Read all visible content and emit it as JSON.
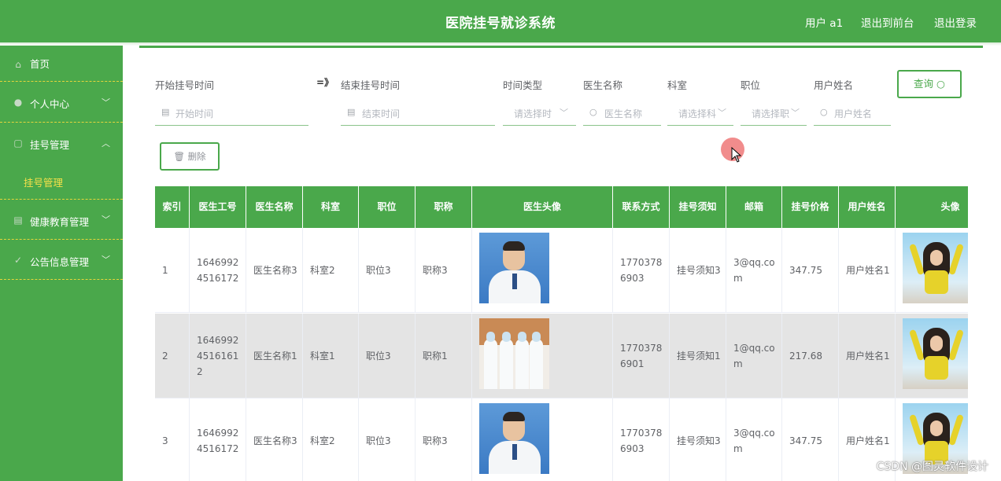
{
  "header": {
    "title": "医院挂号就诊系统",
    "user": "用户 a1",
    "to_front": "退出到前台",
    "logout": "退出登录"
  },
  "sidebar": {
    "items": [
      {
        "label": "首页",
        "icon": "home-icon"
      },
      {
        "label": "个人中心",
        "icon": "user-icon",
        "arrow": "﹀"
      },
      {
        "label": "挂号管理",
        "icon": "calendar-icon",
        "arrow": "︿"
      },
      {
        "label": "健康教育管理",
        "icon": "book-icon",
        "arrow": "﹀"
      },
      {
        "label": "公告信息管理",
        "icon": "bell-icon",
        "arrow": "﹀"
      }
    ],
    "sub_item": "挂号管理"
  },
  "filters": {
    "start_label": "开始挂号时间",
    "start_ph": "开始时间",
    "sep": "=》",
    "end_label": "结束挂号时间",
    "end_ph": "结束时间",
    "type_label": "时间类型",
    "type_ph": "请选择时",
    "doctor_label": "医生名称",
    "doctor_ph": "医生名称",
    "dept_label": "科室",
    "dept_ph": "请选择科",
    "position_label": "职位",
    "position_ph": "请选择职",
    "username_label": "用户姓名",
    "username_ph": "用户姓名",
    "query_btn": "查询 ○",
    "delete_btn": "删除"
  },
  "table": {
    "columns": [
      "索引",
      "医生工号",
      "医生名称",
      "科室",
      "职位",
      "职称",
      "医生头像",
      "联系方式",
      "挂号须知",
      "邮箱",
      "挂号价格",
      "用户姓名",
      "头像"
    ],
    "rows": [
      {
        "index": "1",
        "doc_no": "16469924516172",
        "doc_name": "医生名称3",
        "dept": "科室2",
        "position": "职位3",
        "title": "职称3",
        "photo": "doctor-photo",
        "phone": "17703786903",
        "notice": "挂号须知3",
        "email": "3@qq.com",
        "price": "347.75",
        "user": "用户姓名1"
      },
      {
        "index": "2",
        "doc_no": "164699245161612",
        "doc_name": "医生名称1",
        "dept": "科室1",
        "position": "职位3",
        "title": "职称1",
        "photo": "team-photo",
        "phone": "17703786901",
        "notice": "挂号须知1",
        "email": "1@qq.com",
        "price": "217.68",
        "user": "用户姓名1"
      },
      {
        "index": "3",
        "doc_no": "16469924516172",
        "doc_name": "医生名称3",
        "dept": "科室2",
        "position": "职位3",
        "title": "职称3",
        "photo": "doctor-photo",
        "phone": "17703786903",
        "notice": "挂号须知3",
        "email": "3@qq.com",
        "price": "347.75",
        "user": "用户姓名1"
      }
    ]
  },
  "watermark": "CSDN @图灵软件设计",
  "colors": {
    "primary": "#4aa84b",
    "submenu_active": "#f5e04a",
    "row_highlight": "#e4e4e4"
  }
}
